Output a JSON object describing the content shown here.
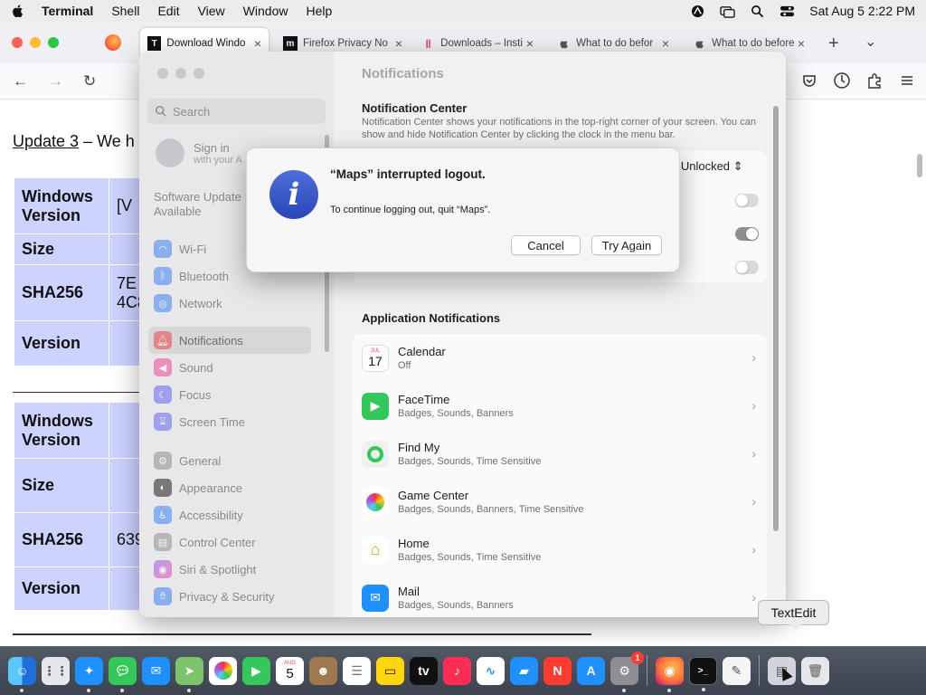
{
  "menubar": {
    "app_name": "Terminal",
    "items": [
      "Shell",
      "Edit",
      "View",
      "Window",
      "Help"
    ],
    "clock": "Sat Aug 5  2:22 PM"
  },
  "browser": {
    "tabs": [
      {
        "label": "Download Windo",
        "favicon": "T",
        "active": true
      },
      {
        "label": "Firefox Privacy No",
        "favicon": "m",
        "active": false
      },
      {
        "label": "Downloads – Insti",
        "favicon": "||",
        "active": false
      },
      {
        "label": "What to do befor",
        "favicon": "apple",
        "active": false
      },
      {
        "label": "What to do before",
        "favicon": "apple",
        "active": false
      }
    ],
    "page": {
      "update_link": "Update 3",
      "update_rest": " – We h",
      "table1": [
        "Windows Version",
        "Size",
        "SHA256",
        "Version"
      ],
      "table1_values": [
        "[V",
        "",
        "7E\n4C8",
        ""
      ],
      "table2": [
        "Windows Version",
        "Size",
        "SHA256",
        "Version"
      ],
      "table2_values": [
        "",
        "",
        "639",
        ""
      ]
    }
  },
  "settings": {
    "title": "Notifications",
    "search_placeholder": "Search",
    "signin_title": "Sign in",
    "signin_sub": "with your A",
    "software_update": "Software Update\nAvailable",
    "sidebar_groups": [
      [
        {
          "label": "Wi‑Fi",
          "icon": "wifi-icon",
          "color": "#3b82f6"
        },
        {
          "label": "Bluetooth",
          "icon": "bluetooth-icon",
          "color": "#3b82f6"
        },
        {
          "label": "Network",
          "icon": "network-icon",
          "color": "#3b82f6"
        }
      ],
      [
        {
          "label": "Notifications",
          "icon": "bell-icon",
          "color": "#ef4444",
          "selected": true
        },
        {
          "label": "Sound",
          "icon": "speaker-icon",
          "color": "#ec4899"
        },
        {
          "label": "Focus",
          "icon": "moon-icon",
          "color": "#6366f1"
        },
        {
          "label": "Screen Time",
          "icon": "hourglass-icon",
          "color": "#6366f1"
        }
      ],
      [
        {
          "label": "General",
          "icon": "gear-icon",
          "color": "#8e8e93"
        },
        {
          "label": "Appearance",
          "icon": "appearance-icon",
          "color": "#1d1d1f"
        },
        {
          "label": "Accessibility",
          "icon": "accessibility-icon",
          "color": "#3b82f6"
        },
        {
          "label": "Control Center",
          "icon": "control-center-icon",
          "color": "#8e8e93"
        },
        {
          "label": "Siri & Spotlight",
          "icon": "siri-icon",
          "color": "#8b5cf6"
        },
        {
          "label": "Privacy & Security",
          "icon": "hand-icon",
          "color": "#3b82f6"
        }
      ]
    ],
    "nc_heading": "Notification Center",
    "nc_desc": "Notification Center shows your notifications in the top-right corner of your screen. You can show and hide Notification Center by clicking the clock in the menu bar.",
    "nc_unlocked": "n Unlocked",
    "app_notifications_heading": "Application Notifications",
    "apps": [
      {
        "name": "Calendar",
        "sub": "Off",
        "icon": "calendar-icon"
      },
      {
        "name": "FaceTime",
        "sub": "Badges, Sounds, Banners",
        "icon": "facetime-icon"
      },
      {
        "name": "Find My",
        "sub": "Badges, Sounds, Time Sensitive",
        "icon": "findmy-icon"
      },
      {
        "name": "Game Center",
        "sub": "Badges, Sounds, Banners, Time Sensitive",
        "icon": "gamecenter-icon"
      },
      {
        "name": "Home",
        "sub": "Badges, Sounds, Time Sensitive",
        "icon": "home-icon"
      },
      {
        "name": "Mail",
        "sub": "Badges, Sounds, Banners",
        "icon": "mail-icon"
      }
    ]
  },
  "dialog": {
    "title": "“Maps” interrupted logout.",
    "message": "To continue logging out, quit “Maps”.",
    "cancel": "Cancel",
    "try_again": "Try Again"
  },
  "calendar_icon": {
    "month": "JUL",
    "day": "17"
  },
  "dock": {
    "tooltip": "TextEdit",
    "system_settings_badge": "1",
    "calendar_day": "5",
    "calendar_month": "AUG"
  }
}
